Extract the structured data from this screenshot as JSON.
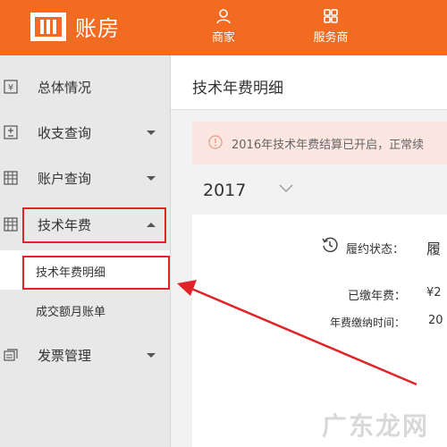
{
  "app": {
    "logo_text": "账房"
  },
  "topnav": [
    {
      "label": "商家",
      "icon": "user-icon"
    },
    {
      "label": "服务商",
      "icon": "grid-icon"
    }
  ],
  "sidebar": {
    "items": [
      {
        "label": "总体情况",
        "icon": "yen-icon"
      },
      {
        "label": "收支查询",
        "icon": "plus-minus-icon"
      },
      {
        "label": "账户查询",
        "icon": "ledger-icon"
      },
      {
        "label": "技术年费",
        "icon": "ledger-icon"
      },
      {
        "label": "发票管理",
        "icon": "invoice-icon"
      }
    ],
    "subitems": [
      {
        "label": "技术年费明细",
        "active": true
      },
      {
        "label": "成交额月账单",
        "active": false
      }
    ]
  },
  "main": {
    "title": "技术年费明细",
    "notice": "2016年技术年费结算已开启，正常续",
    "year": "2017",
    "card": {
      "status_label": "履约状态：",
      "status_value": "履",
      "paid_label": "已缴年费：",
      "paid_value": "¥2",
      "paytime_label": "年费缴纳时间：",
      "paytime_value": "20"
    }
  },
  "watermark": "广东龙网",
  "colors": {
    "brand": "#f26b21",
    "highlight": "#e0242a",
    "notice_bg": "#fbe6e1"
  }
}
